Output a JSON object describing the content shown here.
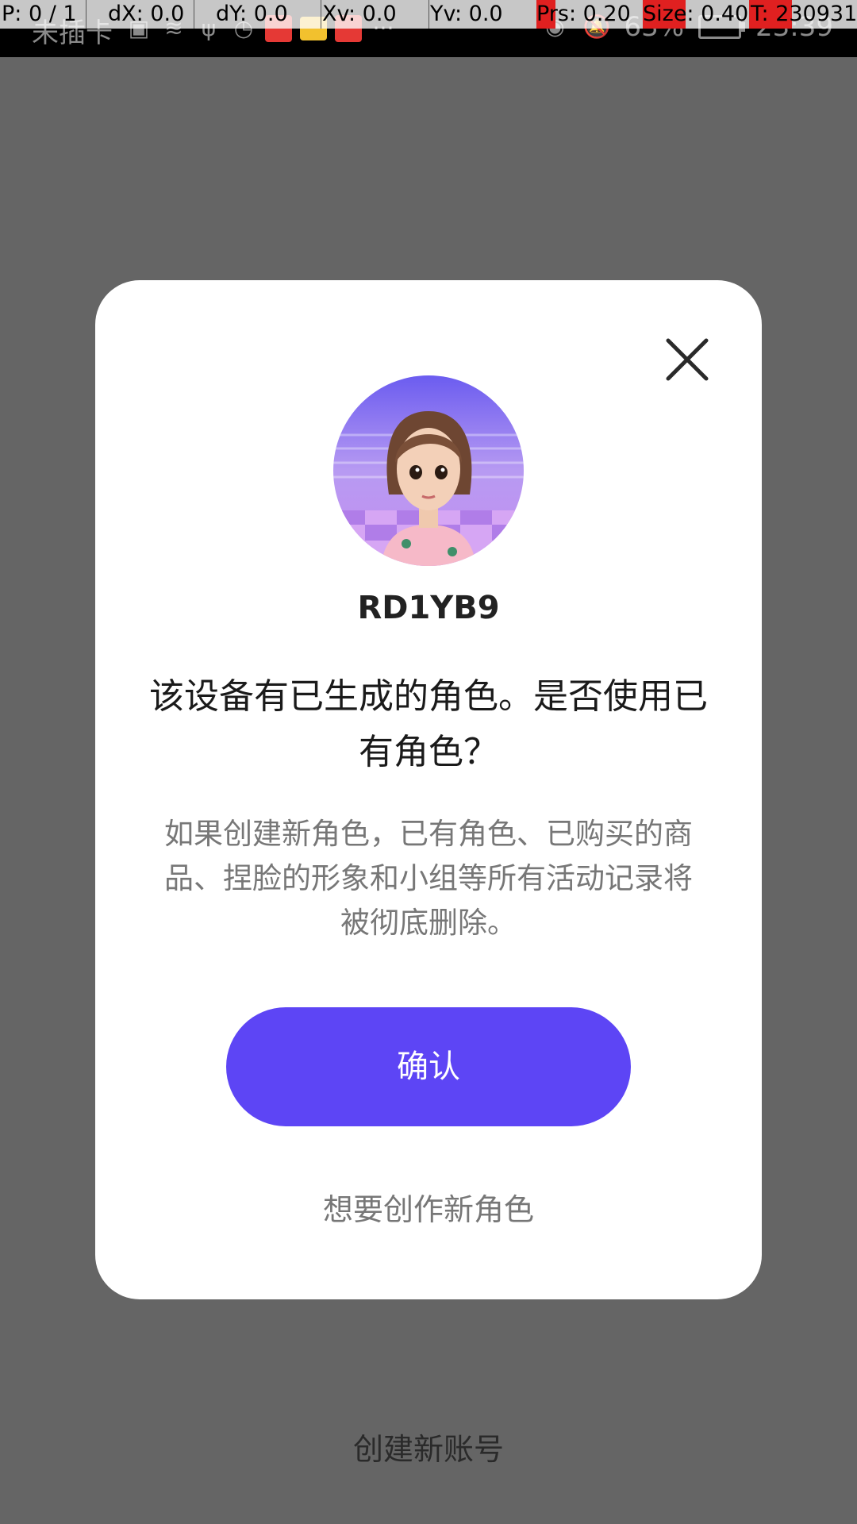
{
  "status_bar": {
    "carrier": "未插卡",
    "battery": "63%",
    "time": "23:39"
  },
  "pointer_overlay": {
    "p": "P: 0 / 1",
    "dx": "dX: 0.0",
    "dy": "dY: 0.0",
    "xv": "Xv: 0.0",
    "yv": "Yv: 0.0",
    "prs": "Prs: 0.20",
    "size": "Size: 0.40",
    "t": "T: 230931"
  },
  "dialog": {
    "username": "RD1YB9",
    "title": "该设备有已生成的角色。是否使用已有角色？",
    "description": "如果创建新角色，已有角色、已购买的商品、捏脸的形象和小组等所有活动记录将被彻底删除。",
    "confirm_label": "确认",
    "create_new_label": "想要创作新角色"
  },
  "bottom": {
    "create_account_label": "创建新账号"
  },
  "colors": {
    "accent": "#5d45f5",
    "backdrop": "#656565",
    "dialog_bg": "#ffffff"
  }
}
